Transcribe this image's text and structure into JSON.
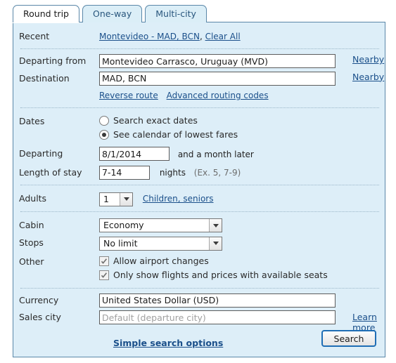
{
  "tabs": [
    {
      "label": "Round trip",
      "active": true
    },
    {
      "label": "One-way",
      "active": false
    },
    {
      "label": "Multi-city",
      "active": false
    }
  ],
  "recent": {
    "label": "Recent",
    "route_link": "Montevideo - MAD, BCN",
    "separator": ", ",
    "clear_link": "Clear All"
  },
  "route": {
    "departing_from_label": "Departing from",
    "departing_from_value": "Montevideo Carrasco, Uruguay (MVD)",
    "departing_from_nearby": "Nearby",
    "destination_label": "Destination",
    "destination_value": "MAD, BCN",
    "destination_nearby": "Nearby",
    "reverse_route_link": "Reverse route",
    "advanced_routing_link": "Advanced routing codes"
  },
  "dates": {
    "label": "Dates",
    "option_exact": "Search exact dates",
    "option_calendar": "See calendar of lowest fares",
    "selected_option": "calendar",
    "departing_label": "Departing",
    "departing_value": "8/1/2014",
    "departing_suffix": "and a month later",
    "length_label": "Length of stay",
    "length_value": "7-14",
    "length_unit": "nights",
    "length_hint": "(Ex. 5, 7-9)"
  },
  "passengers": {
    "adults_label": "Adults",
    "adults_value": "1",
    "children_link": "Children, seniors"
  },
  "options": {
    "cabin_label": "Cabin",
    "cabin_value": "Economy",
    "stops_label": "Stops",
    "stops_value": "No limit",
    "other_label": "Other",
    "allow_airport_changes": "Allow airport changes",
    "allow_airport_changes_checked": true,
    "only_available_seats": "Only show flights and prices with available seats",
    "only_available_seats_checked": true
  },
  "money": {
    "currency_label": "Currency",
    "currency_value": "United States Dollar (USD)",
    "sales_city_label": "Sales city",
    "sales_city_value": "",
    "sales_city_placeholder": "Default (departure city)",
    "learn_more_link": "Learn more"
  },
  "footer": {
    "simple_search_link": "Simple search options",
    "search_button": "Search"
  },
  "colors": {
    "panel_bg": "#ddeef8",
    "panel_border": "#5a87a8",
    "link": "#1a4f8a",
    "button_border": "#1f6eb5"
  }
}
